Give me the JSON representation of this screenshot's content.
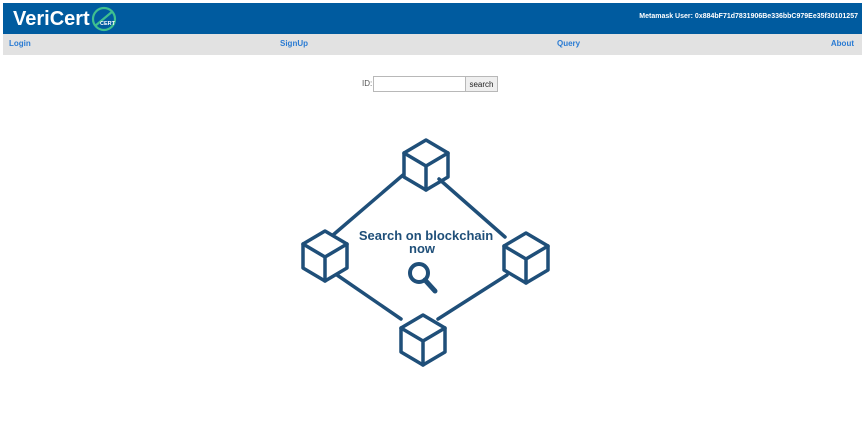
{
  "header": {
    "brand": "VeriCert",
    "logo_text": "CERT",
    "metamask_label": "Metamask User:",
    "metamask_address": "0x884bF71d7831906Be336bbC979Ee35f30101257"
  },
  "nav": {
    "login": "Login",
    "signup": "SignUp",
    "query": "Query",
    "about": "About"
  },
  "search": {
    "id_label": "ID:",
    "placeholder": "",
    "value": "",
    "button_label": "search"
  },
  "illustration": {
    "line1": "Search on blockchain",
    "line2": "now"
  },
  "colors": {
    "header_bg": "#005b9f",
    "nav_bg": "#e2e2e2",
    "nav_link": "#2a7bd3",
    "illustration": "#1f4f79"
  }
}
